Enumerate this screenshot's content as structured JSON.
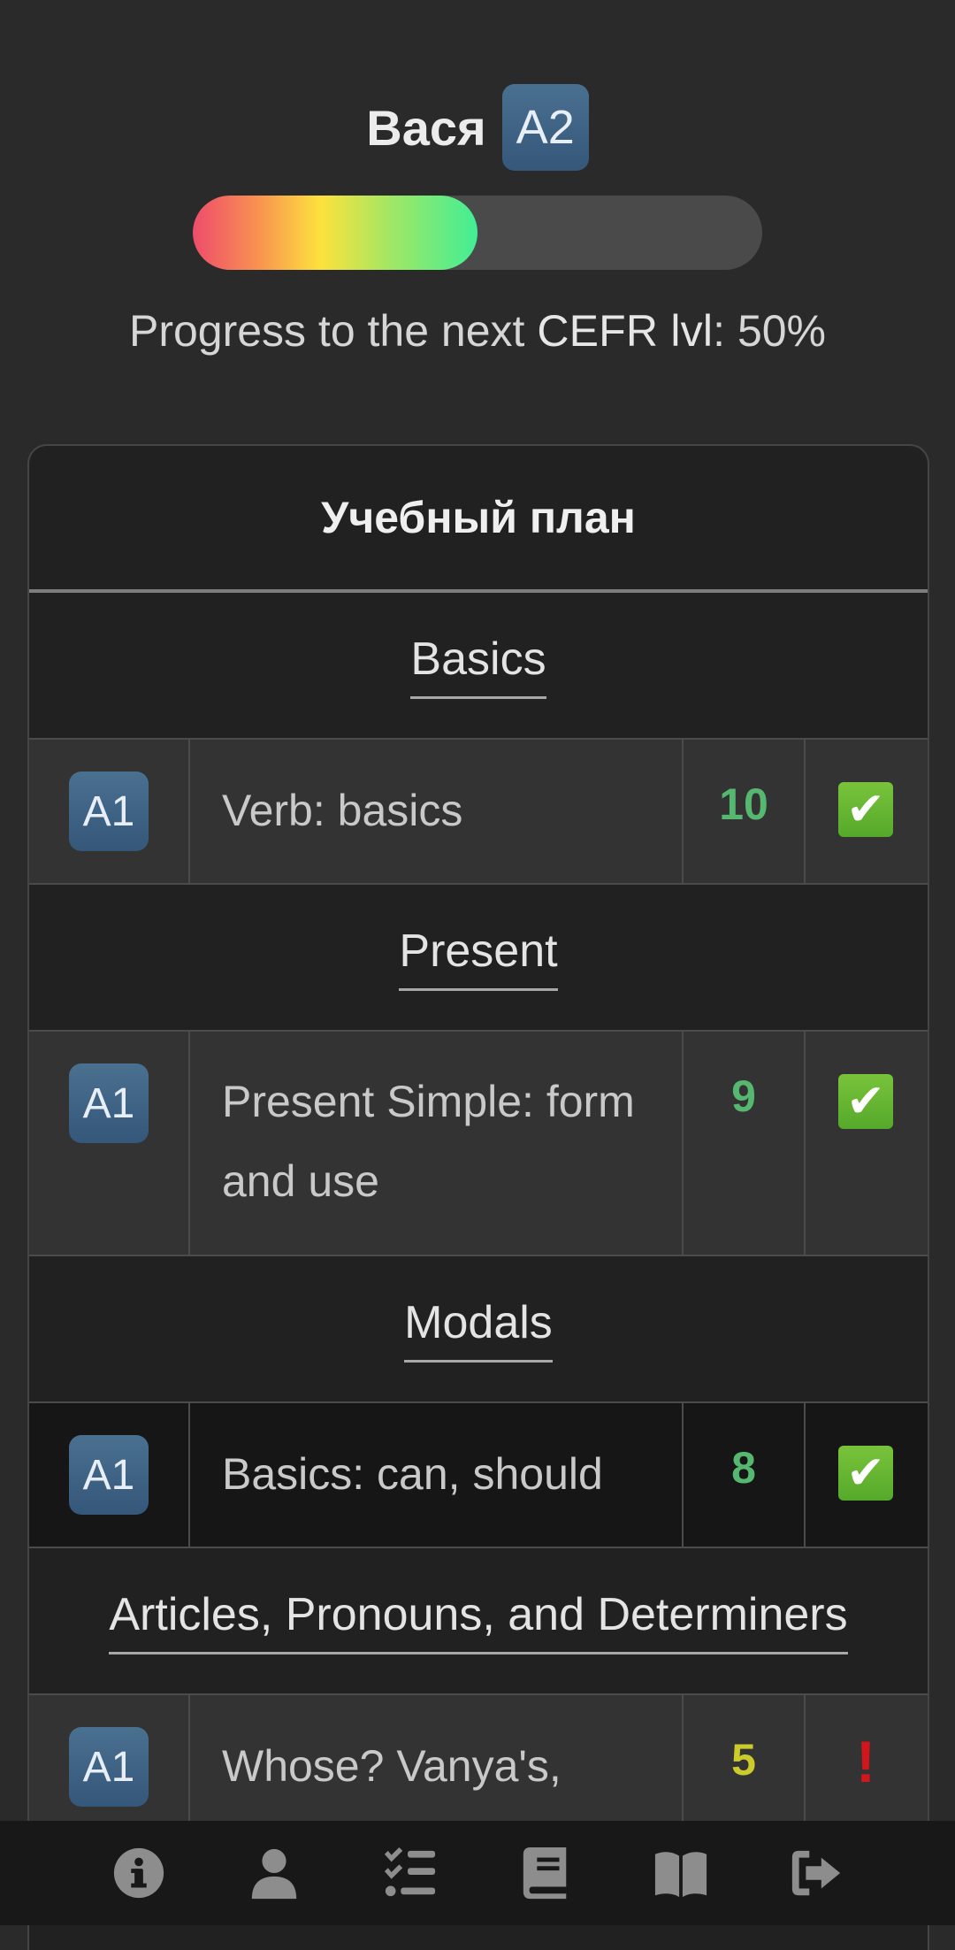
{
  "user": {
    "name": "Вася",
    "level": "A2",
    "progress_percent": 50,
    "progress_prefix": "Progress to the next ",
    "progress_strong": "CEFR lvl",
    "progress_suffix": ": 50%"
  },
  "plan": {
    "title": "Учебный план",
    "sections": [
      {
        "title": "Basics",
        "lessons": [
          {
            "level": "A1",
            "topic": "Verb: basics",
            "score": "10",
            "status": "check-icon"
          }
        ]
      },
      {
        "title": "Present",
        "lessons": [
          {
            "level": "A1",
            "topic": "Present Simple: form and use",
            "score": "9",
            "status": "check-icon"
          }
        ]
      },
      {
        "title": "Modals",
        "lessons": [
          {
            "level": "A1",
            "topic": "Basics: can, should",
            "score": "8",
            "status": "check-icon"
          }
        ]
      },
      {
        "title": "Articles, Pronouns, and Determiners",
        "lessons": [
          {
            "level": "A1",
            "topic": "Whose? Vanya's,",
            "score": "5",
            "status": "exclamation-icon"
          }
        ]
      }
    ]
  },
  "nav": [
    {
      "icon": "info-icon"
    },
    {
      "icon": "user-icon"
    },
    {
      "icon": "tasks-icon"
    },
    {
      "icon": "book-icon"
    },
    {
      "icon": "open-book-icon"
    },
    {
      "icon": "sign-out-icon"
    }
  ],
  "colors": {
    "background": "#2a2a2a",
    "badge": "#3f6586",
    "score_good": "#56b870",
    "score_warn": "#cbcb2b",
    "alert": "#d3161c"
  }
}
